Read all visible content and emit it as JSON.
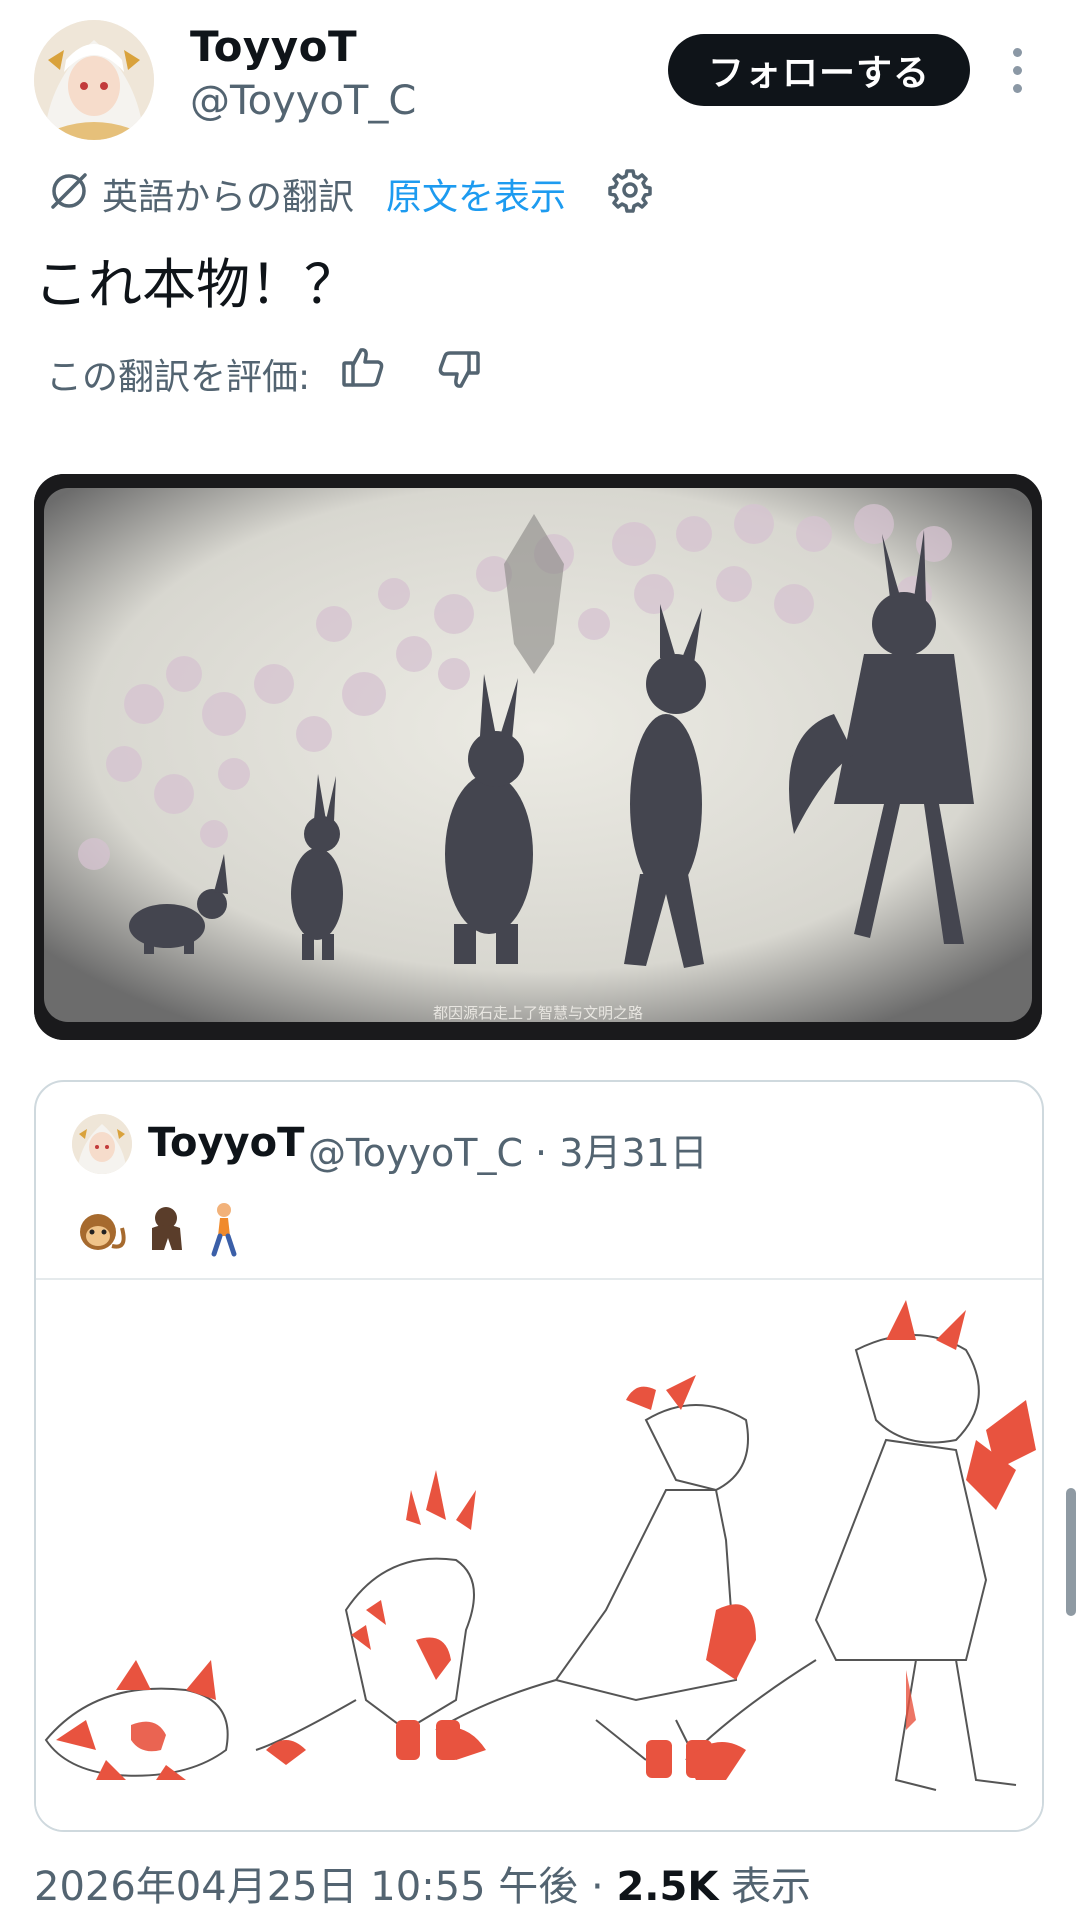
{
  "tweet": {
    "author": {
      "display_name": "ToyyoT",
      "handle": "@ToyyoT_C"
    },
    "follow_label": "フォローする",
    "translation": {
      "label": "英語からの翻訳",
      "show_original": "原文を表示"
    },
    "text": "これ本物！？",
    "rate_translation_label": "この翻訳を評価:",
    "media": {
      "caption": "都因源石走上了智慧与文明之路"
    },
    "quote": {
      "display_name": "ToyyoT",
      "handle_date": "@ToyyoT_C · 3月31日",
      "emojis": "🐒 🦍 🚶"
    },
    "footer": {
      "timestamp": "2026年04月25日 10:55 午後 · ",
      "views_count": "2.5K",
      "views_label": " 表示"
    }
  },
  "icons": {
    "translate": "translate-icon",
    "settings": "gear-icon",
    "thumb_up": "thumb-up-icon",
    "thumb_down": "thumb-down-icon",
    "more": "more-vertical-icon"
  },
  "colors": {
    "link": "#1d9bf0",
    "secondary_text": "#536471",
    "primary_text": "#0f1419",
    "follow_button_bg": "#0f1419",
    "accent_red": "#e8533f"
  }
}
